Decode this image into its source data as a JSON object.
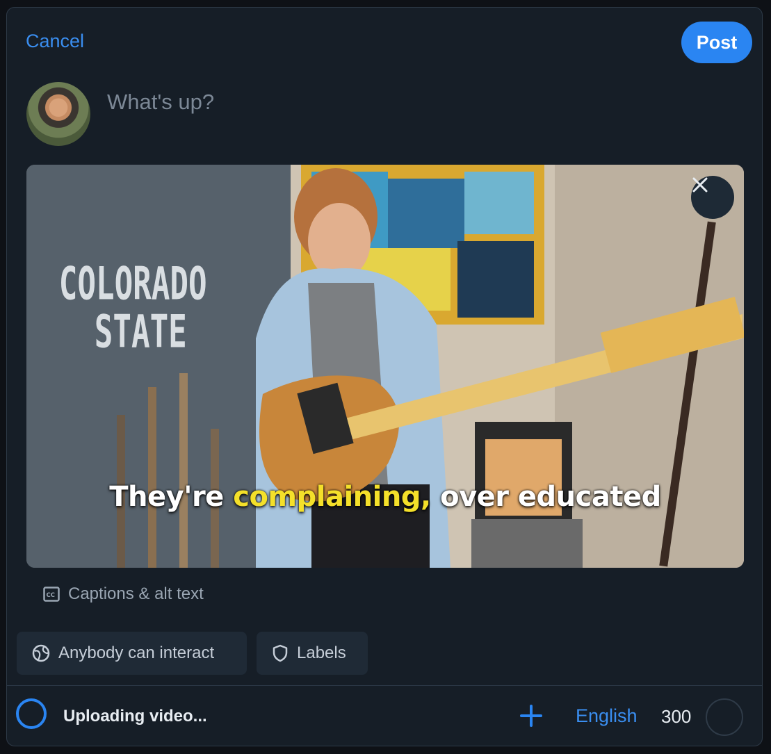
{
  "header": {
    "cancel_label": "Cancel",
    "post_label": "Post"
  },
  "composer": {
    "placeholder": "What's up?"
  },
  "media": {
    "shirt_text_line1": "COLORADO",
    "shirt_text_line2": "STATE",
    "caption_before": "They're ",
    "caption_highlight": "complaining,",
    "caption_after": " over educated"
  },
  "captions_link": {
    "label": "Captions & alt text",
    "icon": "cc-icon"
  },
  "controls": {
    "interaction_label": "Anybody can interact",
    "interaction_icon": "globe-icon",
    "labels_label": "Labels",
    "labels_icon": "shield-icon"
  },
  "footer": {
    "status_text": "Uploading video...",
    "language": "English",
    "char_count": "300"
  },
  "colors": {
    "accent": "#2a85f2",
    "caption_highlight": "#f4e02a",
    "background": "#161e27"
  }
}
